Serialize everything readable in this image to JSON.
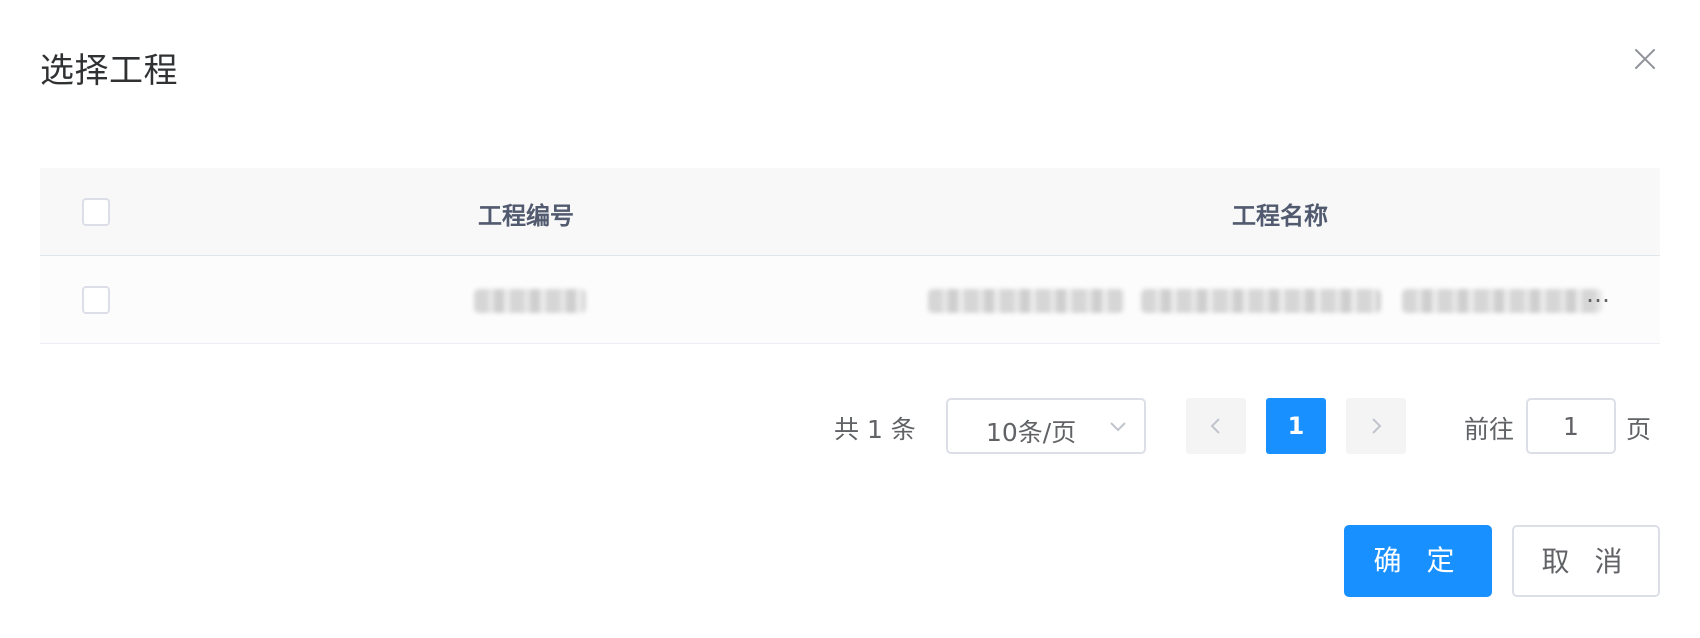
{
  "dialog": {
    "title": "选择工程",
    "close_icon": "close-icon"
  },
  "table": {
    "columns": [
      "",
      "工程编号",
      "工程名称"
    ],
    "rows": [
      {
        "code": "",
        "name": "",
        "name_truncation": "…"
      }
    ]
  },
  "pagination": {
    "total_text": "共 1 条",
    "page_size": "10条/页",
    "current_page": "1",
    "goto_label": "前往",
    "goto_value": "1",
    "goto_suffix": "页"
  },
  "footer": {
    "confirm_label": "确 定",
    "cancel_label": "取 消"
  },
  "colors": {
    "primary": "#1890ff",
    "header_bg": "#f8f8f9",
    "border": "#dcdfe6"
  }
}
